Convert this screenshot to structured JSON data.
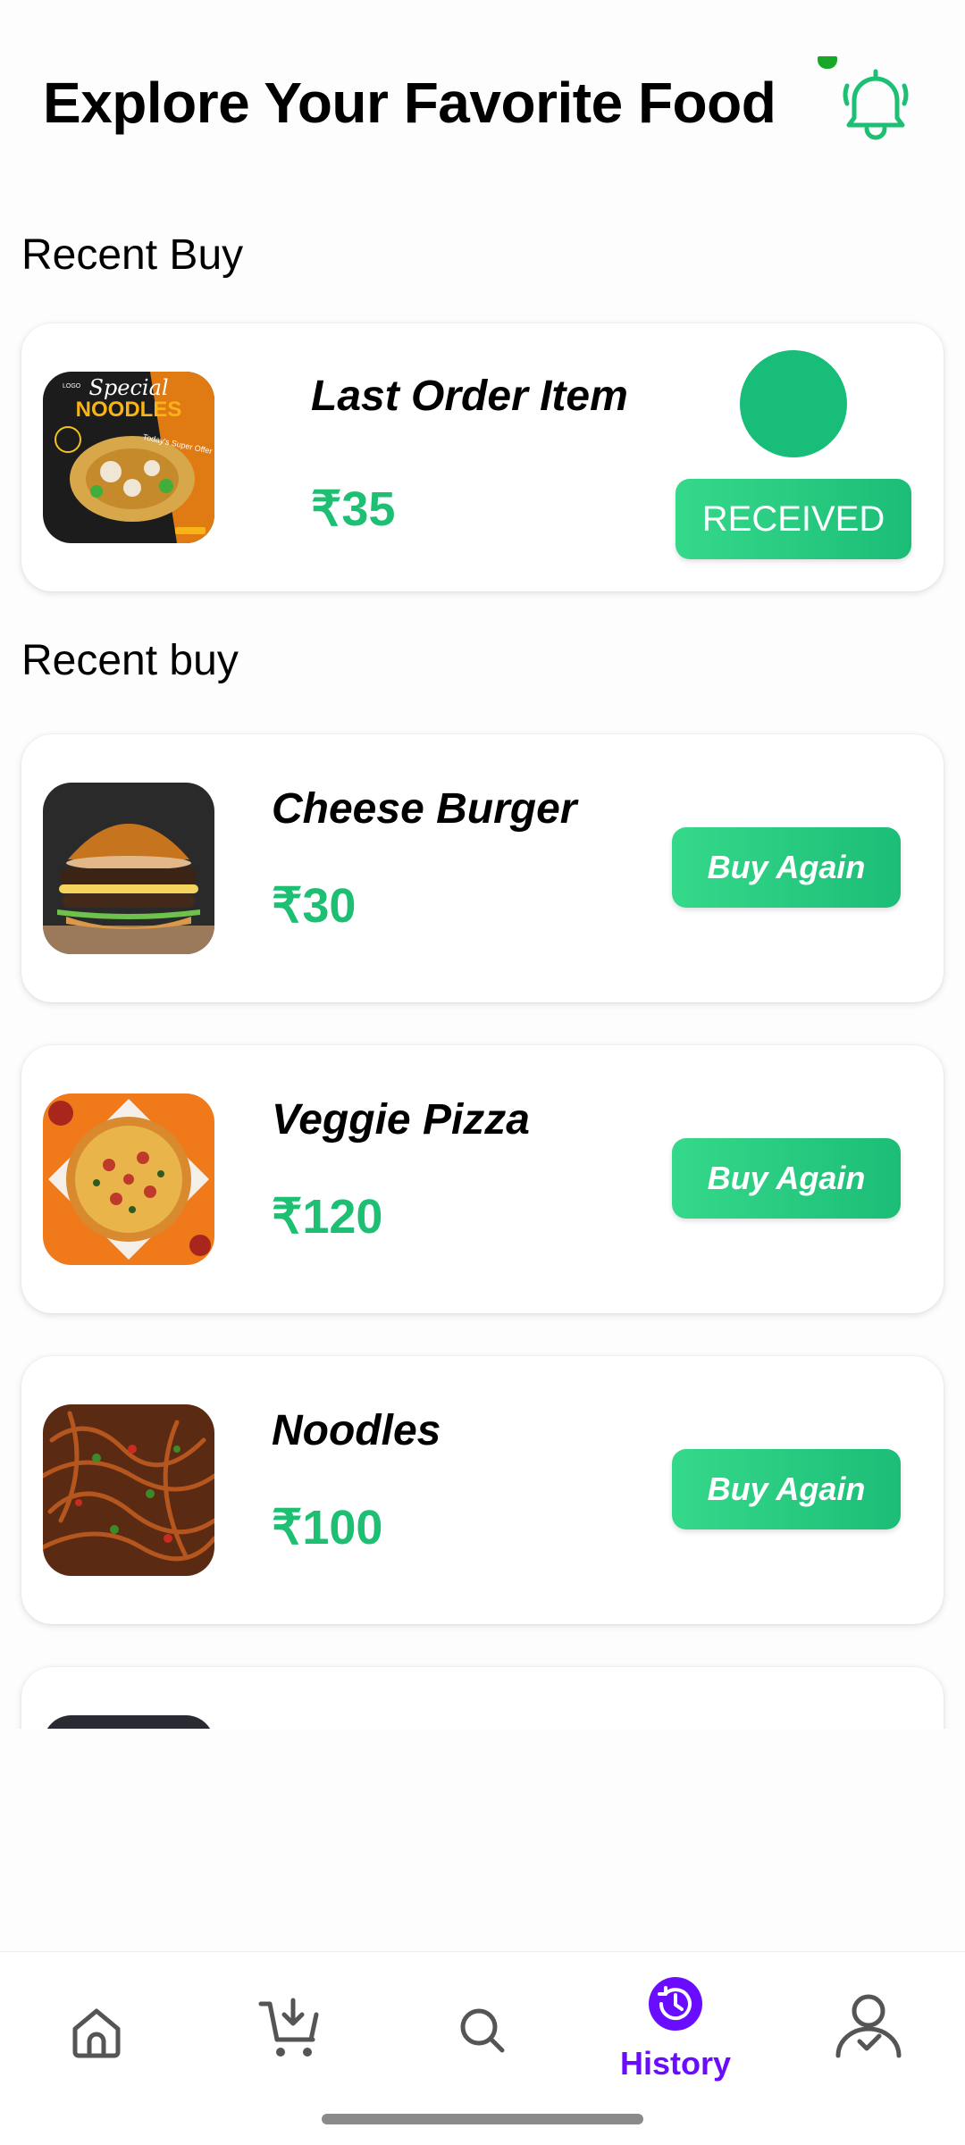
{
  "header": {
    "title": "Explore Your Favorite Food",
    "bell_icon": "bell-icon"
  },
  "last_order": {
    "section_title": "Recent Buy",
    "name": "Last Order Item",
    "price": "₹35",
    "status_button": "RECEIVED",
    "thumb_text": {
      "line1": "Special",
      "line2": "NOODLES",
      "tag": "Today's Super Offer",
      "logo": "LOGO"
    }
  },
  "recent": {
    "section_title": "Recent buy",
    "items": [
      {
        "name": "Cheese Burger",
        "price": "₹30",
        "button": "Buy Again"
      },
      {
        "name": "Veggie Pizza",
        "price": "₹120",
        "button": "Buy Again"
      },
      {
        "name": "Noodles",
        "price": "₹100",
        "button": "Buy Again"
      }
    ]
  },
  "nav": {
    "items": [
      {
        "icon": "home-icon"
      },
      {
        "icon": "cart-icon"
      },
      {
        "icon": "search-icon"
      },
      {
        "icon": "history-icon",
        "label": "History",
        "active": true
      },
      {
        "icon": "profile-icon"
      }
    ]
  },
  "colors": {
    "accent_green": "#1dbf73",
    "active_nav": "#6a0dff"
  }
}
